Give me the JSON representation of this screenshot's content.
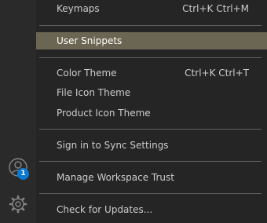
{
  "activity_bar": {
    "accounts_icon": "account-icon",
    "accounts_badge": "1",
    "manage_icon": "gear-icon"
  },
  "menu": {
    "items": [
      {
        "label": "Keymaps",
        "keybinding": "Ctrl+K Ctrl+M"
      },
      {
        "label": "User Snippets",
        "keybinding": "",
        "selected": true
      },
      {
        "label": "Color Theme",
        "keybinding": "Ctrl+K Ctrl+T"
      },
      {
        "label": "File Icon Theme",
        "keybinding": ""
      },
      {
        "label": "Product Icon Theme",
        "keybinding": ""
      },
      {
        "label": "Sign in to Sync Settings",
        "keybinding": ""
      },
      {
        "label": "Manage Workspace Trust",
        "keybinding": ""
      },
      {
        "label": "Check for Updates...",
        "keybinding": ""
      }
    ]
  },
  "colors": {
    "menu_background": "#252526",
    "selected_background": "#6b6653",
    "badge": "#0a7ad6",
    "separator": "#606060"
  }
}
